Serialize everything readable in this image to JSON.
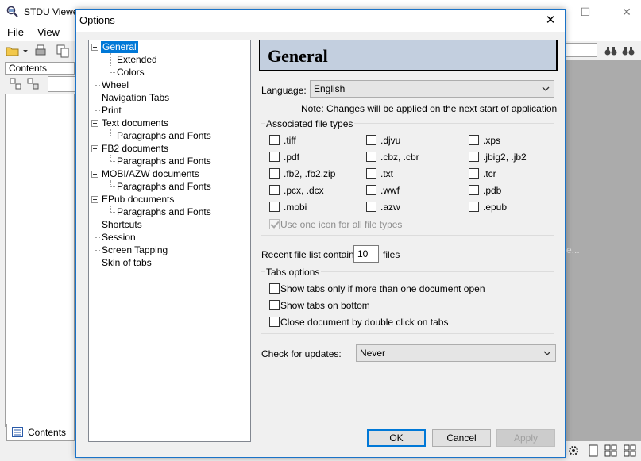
{
  "app": {
    "title": "STDU Viewe",
    "menu": [
      "File",
      "View"
    ],
    "contents_header": "Contents",
    "contents_tab": "Contents",
    "doc_hint": "re..."
  },
  "dialog": {
    "title": "Options",
    "close_glyph": "✕",
    "tree": {
      "items": [
        {
          "label": "General",
          "level": 0,
          "expandable": true,
          "selected": true
        },
        {
          "label": "Extended",
          "level": 1
        },
        {
          "label": "Colors",
          "level": 1
        },
        {
          "label": "Wheel",
          "level": 0
        },
        {
          "label": "Navigation Tabs",
          "level": 0
        },
        {
          "label": "Print",
          "level": 0
        },
        {
          "label": "Text documents",
          "level": 0,
          "expandable": true
        },
        {
          "label": "Paragraphs and Fonts",
          "level": 1
        },
        {
          "label": "FB2 documents",
          "level": 0,
          "expandable": true
        },
        {
          "label": "Paragraphs and Fonts",
          "level": 1
        },
        {
          "label": "MOBI/AZW documents",
          "level": 0,
          "expandable": true
        },
        {
          "label": "Paragraphs and Fonts",
          "level": 1
        },
        {
          "label": "EPub documents",
          "level": 0,
          "expandable": true
        },
        {
          "label": "Paragraphs and Fonts",
          "level": 1
        },
        {
          "label": "Shortcuts",
          "level": 0
        },
        {
          "label": "Session",
          "level": 0
        },
        {
          "label": "Screen Tapping",
          "level": 0
        },
        {
          "label": "Skin of tabs",
          "level": 0
        }
      ]
    },
    "page_title": "General",
    "language": {
      "label": "Language:",
      "value": "English"
    },
    "note": "Note: Changes will be applied on the next start of application",
    "assoc": {
      "title": "Associated file types",
      "types": [
        ".tiff",
        ".djvu",
        ".xps",
        ".pdf",
        ".cbz, .cbr",
        ".jbig2, .jb2",
        ".fb2, .fb2.zip",
        ".txt",
        ".tcr",
        ".pcx, .dcx",
        ".wwf",
        ".pdb",
        ".mobi",
        ".azw",
        ".epub"
      ],
      "one_icon": "Use one icon for all file types"
    },
    "recent": {
      "label": "Recent file list contains:",
      "value": "10",
      "suffix": "files"
    },
    "tabs": {
      "title": "Tabs options",
      "options": [
        "Show tabs only if more than one document open",
        "Show tabs on bottom",
        "Close document by double click on tabs"
      ]
    },
    "updates": {
      "label": "Check for updates:",
      "value": "Never"
    },
    "buttons": {
      "ok": "OK",
      "cancel": "Cancel",
      "apply": "Apply"
    },
    "colors": {
      "selection": "#0078d7",
      "header_bg": "#c3cfdf"
    }
  }
}
